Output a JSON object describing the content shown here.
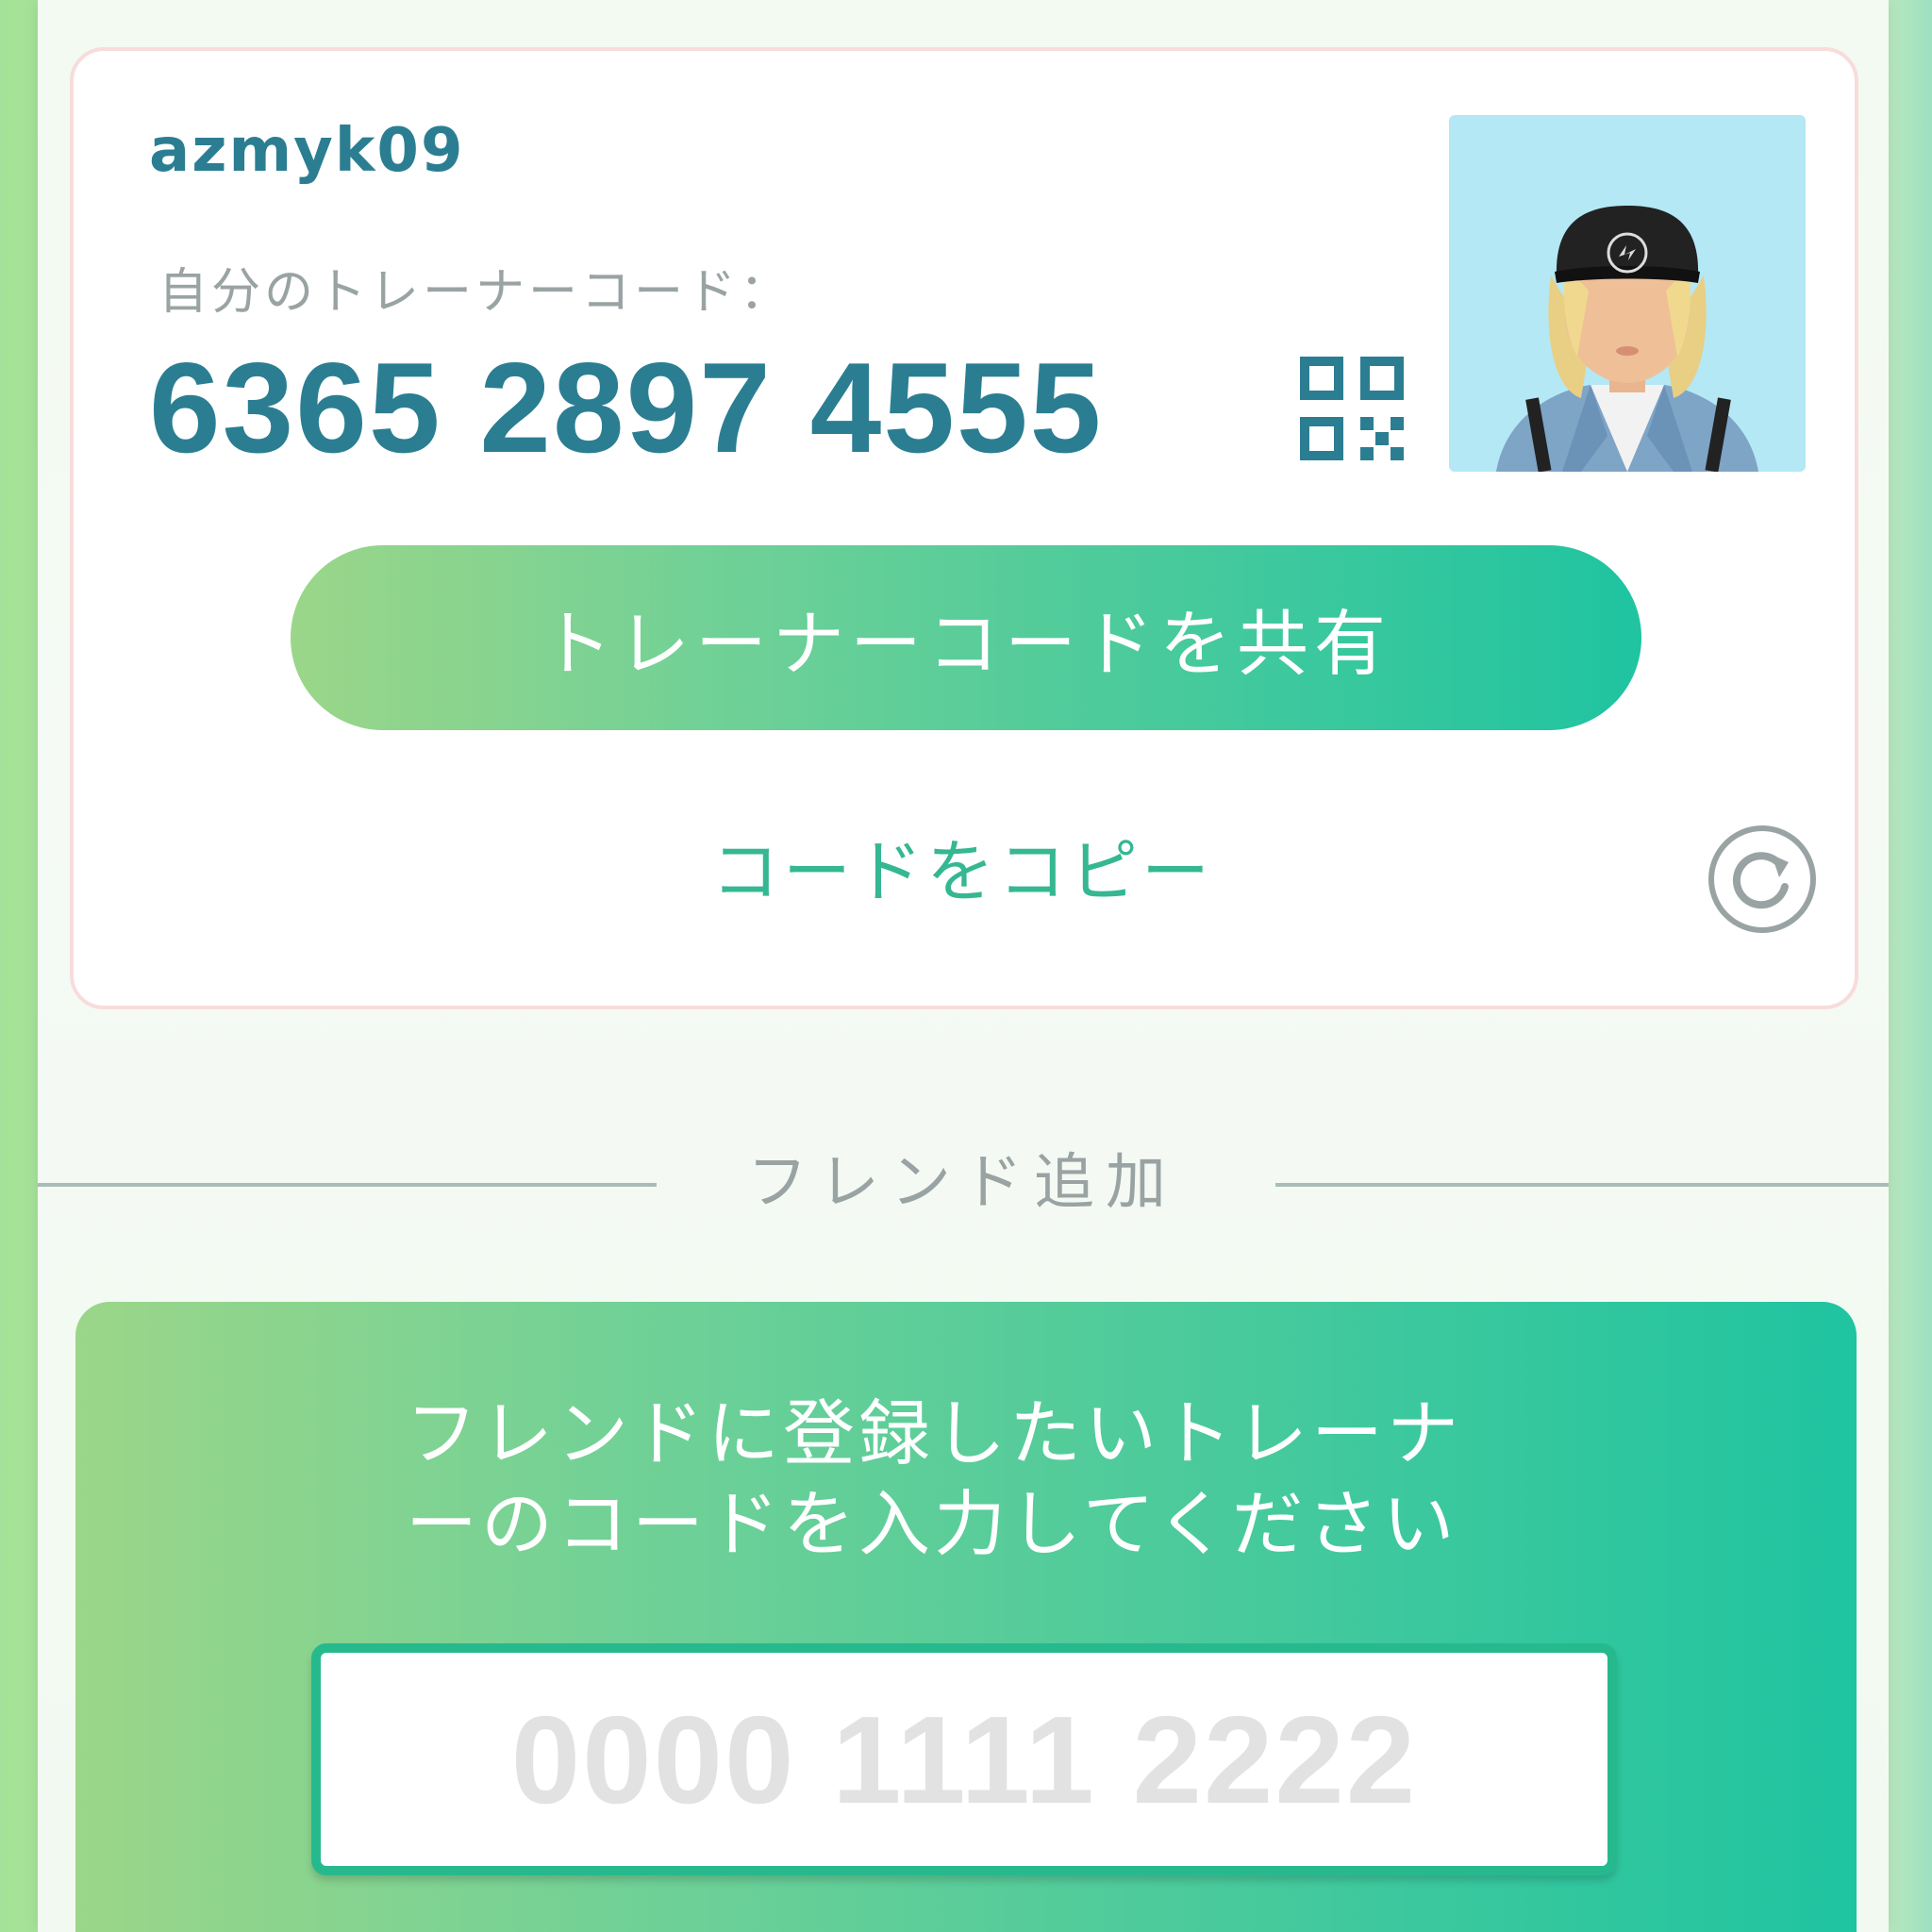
{
  "profile": {
    "username": "azmyk09",
    "code_label": "自分のトレーナーコード：",
    "trainer_code": "6365 2897 4555"
  },
  "actions": {
    "share_label": "トレーナーコードを共有",
    "copy_label": "コードをコピー"
  },
  "add_friend": {
    "section_title": "フレンド追加",
    "instruction_line1": "フレンドに登録したいトレーナ",
    "instruction_line2": "ーのコードを入力してください",
    "input_placeholder": "0000 1111 2222",
    "input_value": ""
  },
  "icons": {
    "qr": "qr-code-icon",
    "refresh": "refresh-icon",
    "avatar": "trainer-avatar"
  },
  "colors": {
    "brand_teal": "#2b7e92",
    "accent_green": "#35b792",
    "gradient_start": "#9bd689",
    "gradient_end": "#1fc4a0"
  }
}
